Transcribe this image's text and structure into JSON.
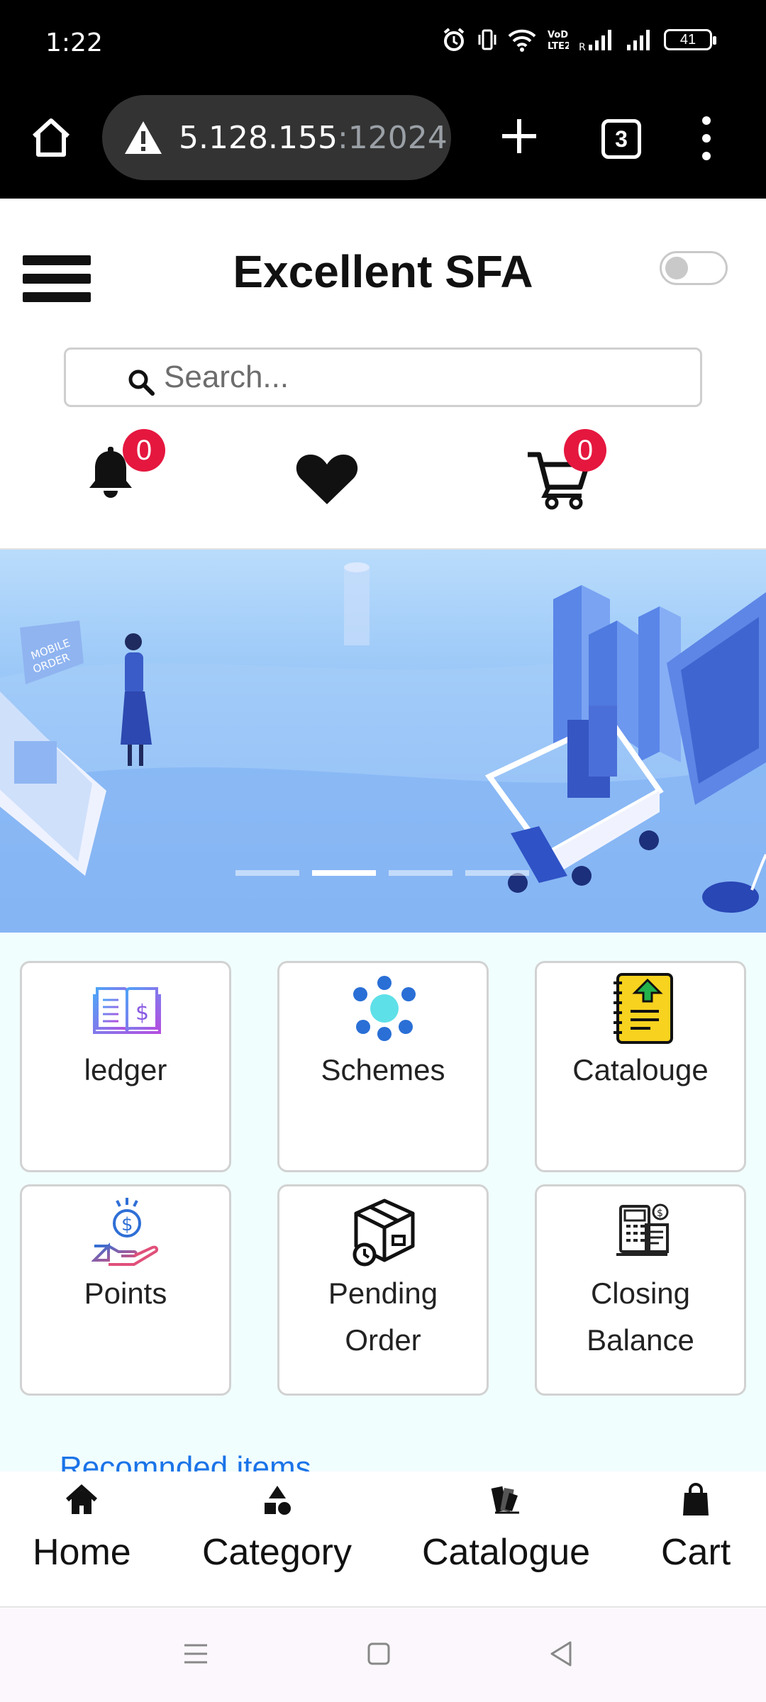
{
  "status_bar": {
    "time": "1:22",
    "battery": "41"
  },
  "browser": {
    "url_host": "5.128.155",
    "url_port": ":12024",
    "tab_count": "3"
  },
  "app": {
    "title": "Excellent SFA",
    "search_placeholder": "Search...",
    "notifications_count": "0",
    "cart_count": "0"
  },
  "banner": {
    "slide_count": 4,
    "active_slide": 2
  },
  "tiles": [
    {
      "label": "ledger",
      "icon": "ledger-book-icon"
    },
    {
      "label": "Schemes",
      "icon": "schemes-network-icon"
    },
    {
      "label": "Catalouge",
      "icon": "catalogue-notebook-icon"
    },
    {
      "label": "Points",
      "icon": "points-coin-hand-icon"
    },
    {
      "label": "Pending Order",
      "icon": "pending-order-box-icon"
    },
    {
      "label": "Closing Balance",
      "icon": "closing-balance-register-icon"
    }
  ],
  "recommended_heading": "Recomnded items",
  "bottom_nav": [
    {
      "label": "Home",
      "icon": "home-icon"
    },
    {
      "label": "Category",
      "icon": "category-shapes-icon"
    },
    {
      "label": "Catalogue",
      "icon": "catalogue-icon"
    },
    {
      "label": "Cart",
      "icon": "shopping-bag-icon"
    }
  ],
  "colors": {
    "badge": "#e5173f",
    "link": "#1a73e8",
    "grid_bg": "#f1fefe"
  }
}
